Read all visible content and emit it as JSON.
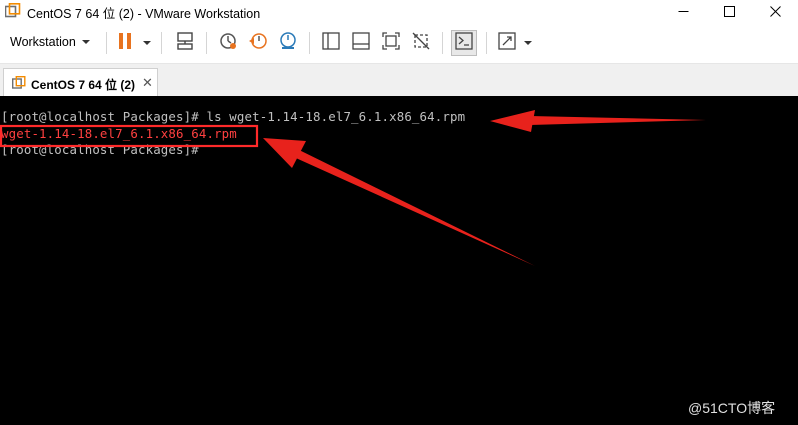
{
  "window": {
    "title": "CentOS 7 64 位 (2) - VMware Workstation",
    "controls": [
      "minimize",
      "maximize",
      "close"
    ]
  },
  "toolbar": {
    "workstation_menu": "Workstation",
    "icons": [
      "pause-icon",
      "send-keys-icon",
      "snapshot-take-icon",
      "snapshot-revert-icon",
      "snapshot-manager-icon",
      "library-view-icon",
      "thumbnail-view-icon",
      "fullscreen-icon",
      "unity-icon",
      "console-view-icon",
      "stretch-view-icon"
    ]
  },
  "tabs": [
    {
      "label": "CentOS 7 64 位 (2)",
      "active": true
    }
  ],
  "console": {
    "lines": [
      "[root@localhost Packages]# ls wget-1.14-18.el7_6.1.x86_64.rpm",
      "wget-1.14-18.el7_6.1.x86_64.rpm",
      "[root@localhost Packages]#"
    ],
    "highlight_color": "#ff3030",
    "text_color": "#c0c0c0"
  },
  "watermark": "@51CTO博客",
  "colors": {
    "accent_orange": "#e8731f",
    "arrow_red": "#e8221c",
    "console_bg": "#000000"
  }
}
